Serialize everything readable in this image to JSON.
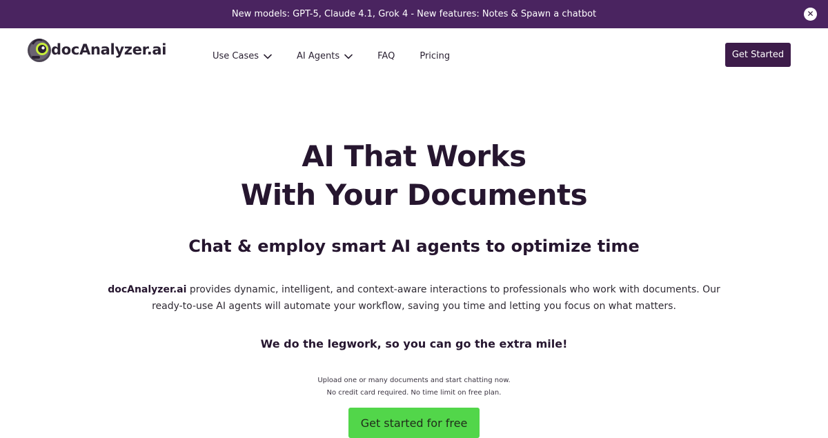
{
  "announcement": {
    "text": "New models: GPT-5, Claude 4.1, Grok 4 - New features: Notes & Spawn a chatbot",
    "close_label": "✕"
  },
  "nav": {
    "logo_text": "docAnalyzer.ai",
    "links": [
      {
        "label": "Use Cases",
        "has_dropdown": true
      },
      {
        "label": "AI Agents",
        "has_dropdown": true
      },
      {
        "label": "FAQ",
        "has_dropdown": false
      },
      {
        "label": "Pricing",
        "has_dropdown": false
      }
    ],
    "cta_label": "Get Started"
  },
  "hero": {
    "title_line1": "AI That Works",
    "title_line2": "With Your Documents",
    "subtitle": "Chat & employ smart AI agents to optimize time",
    "desc_brand": "docAnalyzer.ai",
    "desc_rest": " provides dynamic, intelligent, and context-aware interactions to professionals who work with documents. Our ready-to-use AI agents will automate your workflow, saving you time and letting you focus on what matters.",
    "tagline": "We do the legwork, so you can go the extra mile!",
    "note_line1": "Upload one or many documents and start chatting now.",
    "note_line2": "No credit card required. No time limit on free plan.",
    "cta_label": "Get started for free"
  },
  "colors": {
    "announcement_bg": "#4a2460",
    "nav_cta_bg": "#3d1c4a",
    "hero_cta_bg": "#52d64a",
    "heading_text": "#26162f"
  },
  "icons": {
    "logo": "robot-head-logo-icon",
    "close": "close-icon",
    "dropdown": "chevron-down-icon"
  }
}
